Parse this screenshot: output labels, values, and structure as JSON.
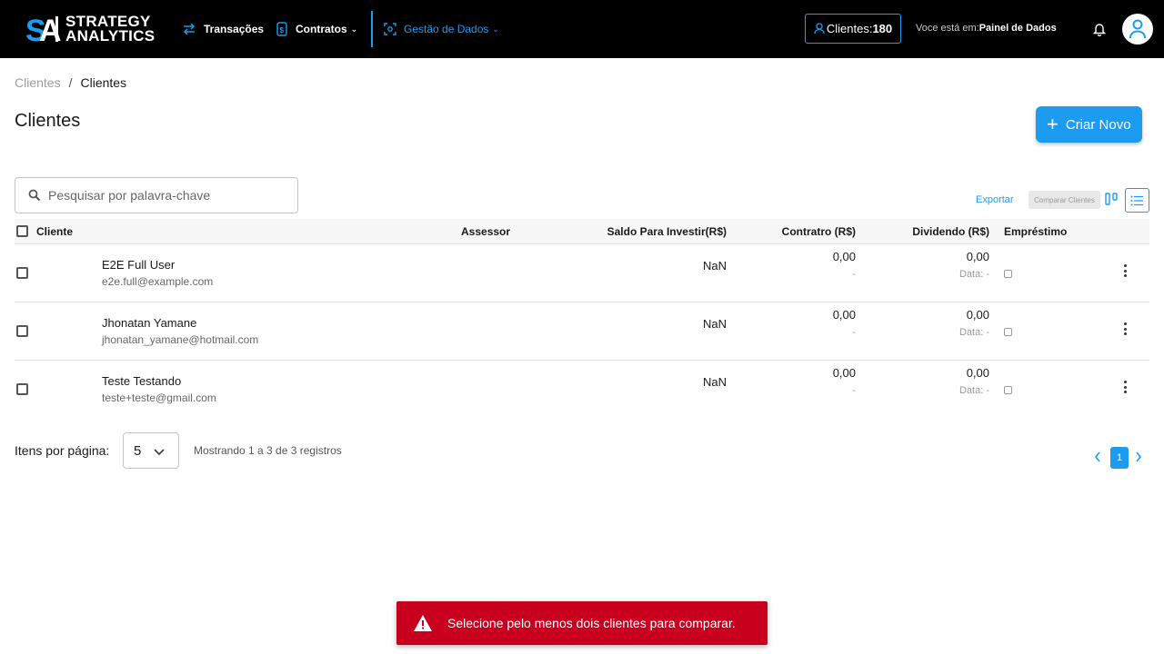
{
  "header": {
    "logo_text_line1": "STRATEGY",
    "logo_text_line2": "ANALYTICS",
    "nav": {
      "transacoes": "Transações",
      "contratos": "Contratos",
      "gestao": "Gestão de Dados"
    },
    "clients_label": "Clientes:",
    "clients_count": "180",
    "location_label": "Voce está em:",
    "location_value": "Painel de Dados",
    "accent_color": "#1b9cf0"
  },
  "breadcrumb": {
    "parent": "Clientes",
    "separator": "/",
    "current": "Clientes"
  },
  "page": {
    "title": "Clientes",
    "create_button": "Criar Novo"
  },
  "search": {
    "placeholder": "Pesquisar por palavra-chave",
    "value": ""
  },
  "toolbar": {
    "export": "Exportar",
    "compare": "Comparar Clientes"
  },
  "table": {
    "columns": {
      "cliente": "Cliente",
      "assessor": "Assessor",
      "saldo": "Saldo Para Investir(R$)",
      "contrato": "Contratro (R$)",
      "dividendo": "Dividendo (R$)",
      "emprestimo": "Empréstimo"
    },
    "rows": [
      {
        "name": "E2E Full User",
        "email": "e2e.full@example.com",
        "saldo": "NaN",
        "contrato": "0,00",
        "contrato_sub": "-",
        "dividendo": "0,00",
        "dividendo_sub": "Data: -"
      },
      {
        "name": "Jhonatan Yamane",
        "email": "jhonatan_yamane@hotmail.com",
        "saldo": "NaN",
        "contrato": "0,00",
        "contrato_sub": "-",
        "dividendo": "0,00",
        "dividendo_sub": "Data: -"
      },
      {
        "name": "Teste Testando",
        "email": "teste+teste@gmail.com",
        "saldo": "NaN",
        "contrato": "0,00",
        "contrato_sub": "-",
        "dividendo": "0,00",
        "dividendo_sub": "Data: -"
      }
    ]
  },
  "pagination": {
    "items_per_page_label": "Itens por página:",
    "items_per_page": "5",
    "showing": "Mostrando 1 a 3 de 3 registros",
    "current_page": "1"
  },
  "toast": {
    "message": "Selecione pelo menos dois clientes para comparar.",
    "color": "#c8001e"
  }
}
